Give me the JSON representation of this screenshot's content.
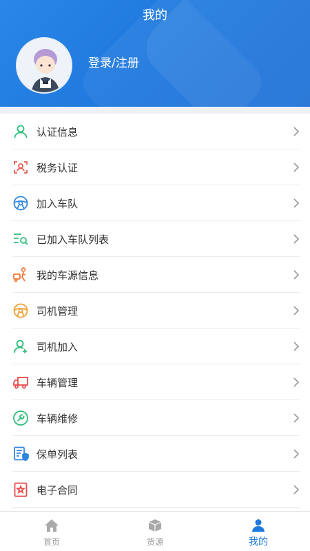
{
  "header": {
    "title": "我的",
    "login_label": "登录/注册"
  },
  "menu": {
    "items": [
      {
        "label": "认证信息",
        "icon": "user-verify-icon",
        "color": "#2bbf7a"
      },
      {
        "label": "税务认证",
        "icon": "face-scan-icon",
        "color": "#e85a4f"
      },
      {
        "label": "加入车队",
        "icon": "steering-wheel-icon",
        "color": "#2f86de"
      },
      {
        "label": "已加入车队列表",
        "icon": "list-search-icon",
        "color": "#2bbf7a"
      },
      {
        "label": "我的车源信息",
        "icon": "delivery-person-icon",
        "color": "#f07a3a"
      },
      {
        "label": "司机管理",
        "icon": "steering-wheel-icon",
        "color": "#f0a030"
      },
      {
        "label": "司机加入",
        "icon": "user-add-icon",
        "color": "#2bbf7a"
      },
      {
        "label": "车辆管理",
        "icon": "truck-icon",
        "color": "#e84a4a"
      },
      {
        "label": "车辆维修",
        "icon": "wrench-icon",
        "color": "#2bbf7a"
      },
      {
        "label": "保单列表",
        "icon": "policy-shield-icon",
        "color": "#2f86de"
      },
      {
        "label": "电子合同",
        "icon": "contract-seal-icon",
        "color": "#e84a4a"
      }
    ]
  },
  "tabbar": {
    "tabs": [
      {
        "label": "首页",
        "icon": "home-icon"
      },
      {
        "label": "货源",
        "icon": "cargo-box-icon"
      },
      {
        "label": "我的",
        "icon": "person-icon",
        "active": true
      }
    ]
  },
  "colors": {
    "primary": "#1f78dd",
    "inactive": "#999999"
  }
}
